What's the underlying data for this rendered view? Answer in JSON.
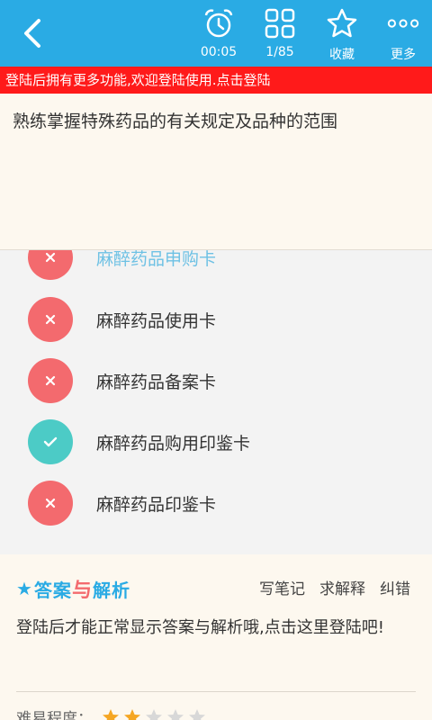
{
  "topbar": {
    "timer_label": "00:05",
    "progress_label": "1/85",
    "favorite_label": "收藏",
    "more_label": "更多"
  },
  "login_banner": "登陆后拥有更多功能,欢迎登陆使用.点击登陆",
  "question": {
    "text": "熟练掌握特殊药品的有关规定及品种的范围"
  },
  "options": [
    {
      "label": "麻醉药品申购卡",
      "state": "wrong"
    },
    {
      "label": "麻醉药品使用卡",
      "state": "wrong"
    },
    {
      "label": "麻醉药品备案卡",
      "state": "wrong"
    },
    {
      "label": "麻醉药品购用印鉴卡",
      "state": "right"
    },
    {
      "label": "麻醉药品印鉴卡",
      "state": "wrong"
    }
  ],
  "analysis": {
    "title_part1": "答案",
    "title_mid": "与",
    "title_part2": "解析",
    "actions": {
      "notes": "写笔记",
      "ask": "求解释",
      "report": "纠错"
    },
    "body": "登陆后才能正常显示答案与解析哦,点击这里登陆吧!",
    "difficulty_label": "难易程度：",
    "difficulty_stars": 2,
    "difficulty_max": 5
  },
  "colors": {
    "primary": "#2aabe4",
    "banner": "#ff1a1a",
    "wrong": "#f36a6e",
    "right": "#4ccbc6",
    "chosen_text": "#6ec1e4",
    "star_on": "#f5a623",
    "star_off": "#d8d8d8"
  }
}
